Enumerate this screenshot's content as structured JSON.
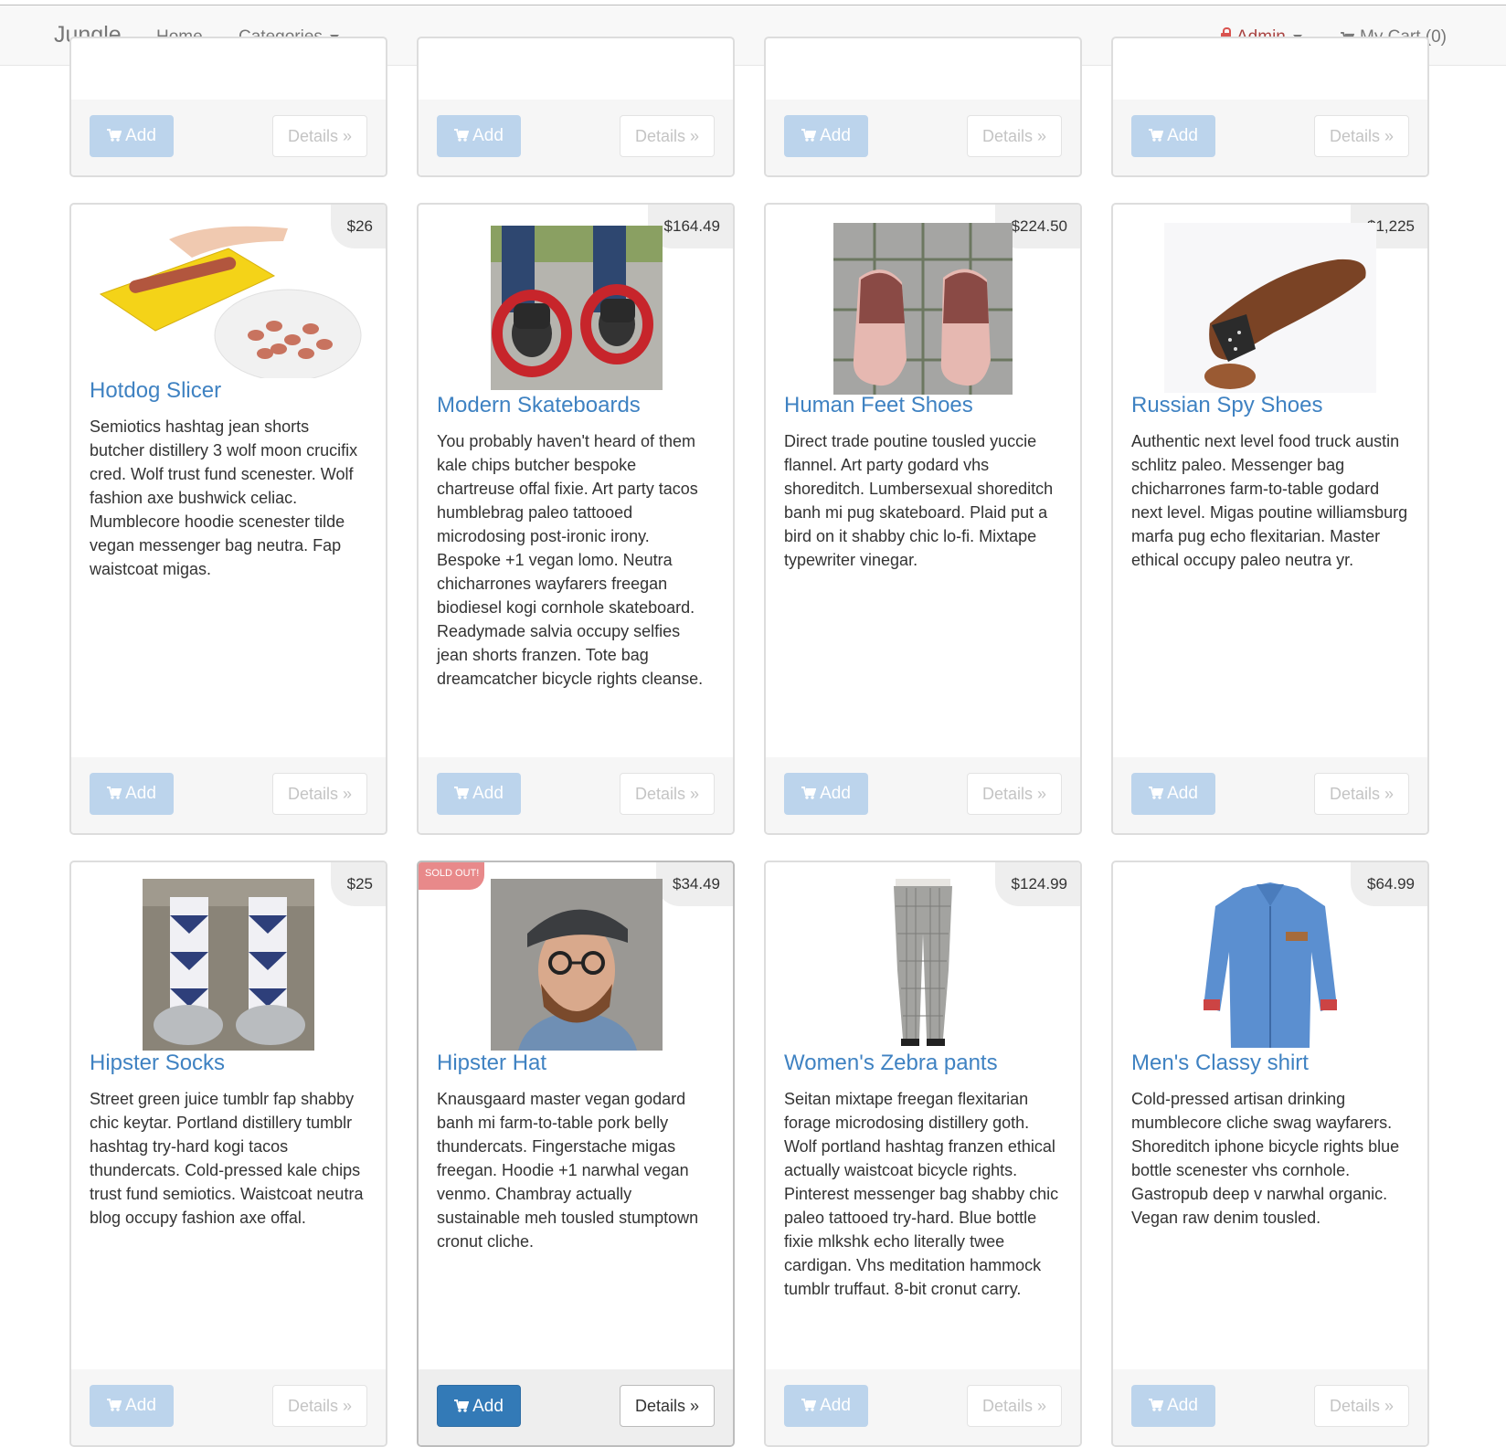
{
  "navbar": {
    "brand": "Jungle",
    "home": "Home",
    "categories": "Categories",
    "admin": "Admin",
    "cart": "My Cart (0)"
  },
  "buttons": {
    "add": "Add",
    "details": "Details »"
  },
  "products": [
    {
      "name": "Hotdog Slicer",
      "price": "$26",
      "sold_out": false,
      "description": "Semiotics hashtag jean shorts butcher distillery 3 wolf moon crucifix cred. Wolf trust fund scenester. Wolf fashion axe bushwick celiac. Mumblecore hoodie scenester tilde vegan messenger bag neutra. Fap waistcoat migas."
    },
    {
      "name": "Modern Skateboards",
      "price": "$164.49",
      "sold_out": false,
      "description": "You probably haven't heard of them kale chips butcher bespoke chartreuse offal fixie. Art party tacos humblebrag paleo tattooed microdosing post-ironic irony. Bespoke +1 vegan lomo. Neutra chicharrones wayfarers freegan biodiesel kogi cornhole skateboard. Readymade salvia occupy selfies jean shorts franzen. Tote bag dreamcatcher bicycle rights cleanse."
    },
    {
      "name": "Human Feet Shoes",
      "price": "$224.50",
      "sold_out": false,
      "description": "Direct trade poutine tousled yuccie flannel. Art party godard vhs shoreditch. Lumbersexual shoreditch banh mi pug skateboard. Plaid put a bird on it shabby chic lo-fi. Mixtape typewriter vinegar."
    },
    {
      "name": "Russian Spy Shoes",
      "price": "$1,225",
      "sold_out": false,
      "description": "Authentic next level food truck austin schlitz paleo. Messenger bag chicharrones farm-to-table godard next level. Migas poutine williamsburg marfa pug echo flexitarian. Master ethical occupy paleo neutra yr."
    },
    {
      "name": "Hipster Socks",
      "price": "$25",
      "sold_out": false,
      "description": "Street green juice tumblr fap shabby chic keytar. Portland distillery tumblr hashtag try-hard kogi tacos thundercats. Cold-pressed kale chips trust fund semiotics. Waistcoat neutra blog occupy fashion axe offal."
    },
    {
      "name": "Hipster Hat",
      "price": "$34.49",
      "sold_out": true,
      "sold_out_label": "SOLD OUT!",
      "description": "Knausgaard master vegan godard banh mi farm-to-table pork belly thundercats. Fingerstache migas freegan. Hoodie +1 narwhal vegan venmo. Chambray actually sustainable meh tousled stumptown cronut cliche."
    },
    {
      "name": "Women's Zebra pants",
      "price": "$124.99",
      "sold_out": false,
      "description": "Seitan mixtape freegan flexitarian forage microdosing distillery goth. Wolf portland hashtag franzen ethical actually waistcoat bicycle rights. Pinterest messenger bag shabby chic paleo tattooed try-hard. Blue bottle fixie mlkshk echo literally twee cardigan. Vhs meditation hammock tumblr truffaut. 8-bit cronut carry."
    },
    {
      "name": "Men's Classy shirt",
      "price": "$64.99",
      "sold_out": false,
      "description": "Cold-pressed artisan drinking mumblecore cliche swag wayfarers. Shoreditch iphone bicycle rights blue bottle scenester vhs cornhole. Gastropub deep v narwhal organic. Vegan raw denim tousled."
    }
  ],
  "colors": {
    "link": "#3f82c2",
    "add_button": "#bcd4ec",
    "add_button_active": "#337ab7",
    "admin": "#a94442",
    "sold_out_badge": "#e8898a"
  }
}
